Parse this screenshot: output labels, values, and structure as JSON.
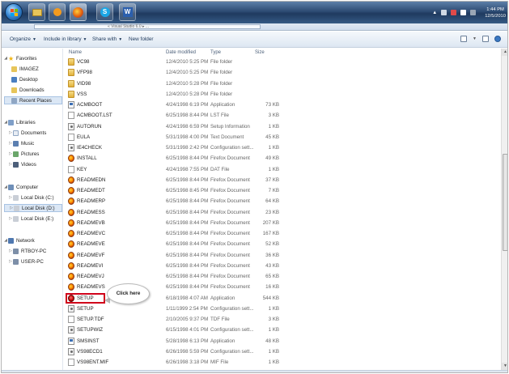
{
  "taskbar": {
    "clock_time": "1:44 PM",
    "clock_date": "12/5/2010",
    "pinned": [
      "start-orb",
      "windows-explorer",
      "media-player",
      "firefox",
      "skype",
      "word"
    ]
  },
  "address": {
    "path": "« Visual Studio 6.0 ▸ ..."
  },
  "toolbar": {
    "organize": "Organize",
    "include": "Include in library",
    "share": "Share with",
    "new_folder": "New folder"
  },
  "nav": {
    "favorites": "Favorites",
    "imagez": "IMAGEZ",
    "desktop": "Desktop",
    "downloads": "Downloads",
    "recent": "Recent Places",
    "libraries": "Libraries",
    "documents": "Documents",
    "music": "Music",
    "pictures": "Pictures",
    "videos": "Videos",
    "computer": "Computer",
    "disk_c": "Local Disk (C:)",
    "disk_d": "Local Disk (D:)",
    "disk_e": "Local Disk (E:)",
    "network": "Network",
    "pc1": "RTBOY-PC",
    "pc2": "USER-PC"
  },
  "columns": {
    "name": "Name",
    "date": "Date modified",
    "type": "Type",
    "size": "Size"
  },
  "files": [
    {
      "name": "VC98",
      "date": "12/4/2010 5:25 PM",
      "type": "File folder",
      "size": "",
      "icon": "folder"
    },
    {
      "name": "VFP98",
      "date": "12/4/2010 5:25 PM",
      "type": "File folder",
      "size": "",
      "icon": "folder"
    },
    {
      "name": "VID98",
      "date": "12/4/2010 5:28 PM",
      "type": "File folder",
      "size": "",
      "icon": "folder"
    },
    {
      "name": "VSS",
      "date": "12/4/2010 5:28 PM",
      "type": "File folder",
      "size": "",
      "icon": "folder"
    },
    {
      "name": "ACMBOOT",
      "date": "4/24/1998 6:19 PM",
      "type": "Application",
      "size": "73 KB",
      "icon": "app"
    },
    {
      "name": "ACMBOOT.LST",
      "date": "6/25/1998 8:44 PM",
      "type": "LST File",
      "size": "3 KB",
      "icon": "doc"
    },
    {
      "name": "AUTORUN",
      "date": "4/24/1998 6:59 PM",
      "type": "Setup Information",
      "size": "1 KB",
      "icon": "cfg"
    },
    {
      "name": "EULA",
      "date": "5/31/1998 4:00 PM",
      "type": "Text Document",
      "size": "45 KB",
      "icon": "doc"
    },
    {
      "name": "IE4CHECK",
      "date": "5/31/1998 2:42 PM",
      "type": "Configuration sett...",
      "size": "1 KB",
      "icon": "cfg"
    },
    {
      "name": "INSTALL",
      "date": "6/25/1998 8:44 PM",
      "type": "Firefox Document",
      "size": "49 KB",
      "icon": "ff"
    },
    {
      "name": "KEY",
      "date": "4/24/1998 7:55 PM",
      "type": "DAT File",
      "size": "1 KB",
      "icon": "doc"
    },
    {
      "name": "READMEDN",
      "date": "6/25/1998 8:44 PM",
      "type": "Firefox Document",
      "size": "37 KB",
      "icon": "ff"
    },
    {
      "name": "READMEDT",
      "date": "6/25/1998 8:45 PM",
      "type": "Firefox Document",
      "size": "7 KB",
      "icon": "ff"
    },
    {
      "name": "READMERP",
      "date": "6/25/1998 8:44 PM",
      "type": "Firefox Document",
      "size": "64 KB",
      "icon": "ff"
    },
    {
      "name": "READMESS",
      "date": "6/25/1998 8:44 PM",
      "type": "Firefox Document",
      "size": "23 KB",
      "icon": "ff"
    },
    {
      "name": "READMEVB",
      "date": "6/25/1998 8:44 PM",
      "type": "Firefox Document",
      "size": "207 KB",
      "icon": "ff"
    },
    {
      "name": "READMEVC",
      "date": "6/25/1998 8:44 PM",
      "type": "Firefox Document",
      "size": "167 KB",
      "icon": "ff"
    },
    {
      "name": "READMEVE",
      "date": "6/25/1998 8:44 PM",
      "type": "Firefox Document",
      "size": "52 KB",
      "icon": "ff"
    },
    {
      "name": "READMEVF",
      "date": "6/25/1998 8:44 PM",
      "type": "Firefox Document",
      "size": "36 KB",
      "icon": "ff"
    },
    {
      "name": "READMEVI",
      "date": "6/25/1998 8:44 PM",
      "type": "Firefox Document",
      "size": "43 KB",
      "icon": "ff"
    },
    {
      "name": "READMEVJ",
      "date": "6/25/1998 8:44 PM",
      "type": "Firefox Document",
      "size": "65 KB",
      "icon": "ff"
    },
    {
      "name": "READMEVS",
      "date": "6/25/1998 8:44 PM",
      "type": "Firefox Document",
      "size": "16 KB",
      "icon": "ff"
    },
    {
      "name": "SETUP",
      "date": "6/18/1998 4:07 AM",
      "type": "Application",
      "size": "544 KB",
      "icon": "setup"
    },
    {
      "name": "SETUP",
      "date": "1/11/1999 2:54 PM",
      "type": "Configuration sett...",
      "size": "1 KB",
      "icon": "cfg"
    },
    {
      "name": "SETUP.TDF",
      "date": "2/10/2005 9:37 PM",
      "type": "TDF File",
      "size": "3 KB",
      "icon": "doc"
    },
    {
      "name": "SETUPWIZ",
      "date": "6/15/1998 4:01 PM",
      "type": "Configuration sett...",
      "size": "1 KB",
      "icon": "cfg"
    },
    {
      "name": "SMSINST",
      "date": "5/28/1998 6:13 PM",
      "type": "Application",
      "size": "48 KB",
      "icon": "app"
    },
    {
      "name": "VS98ECD1",
      "date": "6/26/1998 5:59 PM",
      "type": "Configuration sett...",
      "size": "1 KB",
      "icon": "cfg"
    },
    {
      "name": "VS98ENT.MIF",
      "date": "6/26/1998 3:18 PM",
      "type": "MIF File",
      "size": "1 KB",
      "icon": "doc"
    }
  ],
  "callout": {
    "text": "Click here"
  },
  "colors": {
    "highlight": "#d0021b",
    "taskbar": "#2d4b73",
    "toolbar_text": "#1e395b"
  }
}
